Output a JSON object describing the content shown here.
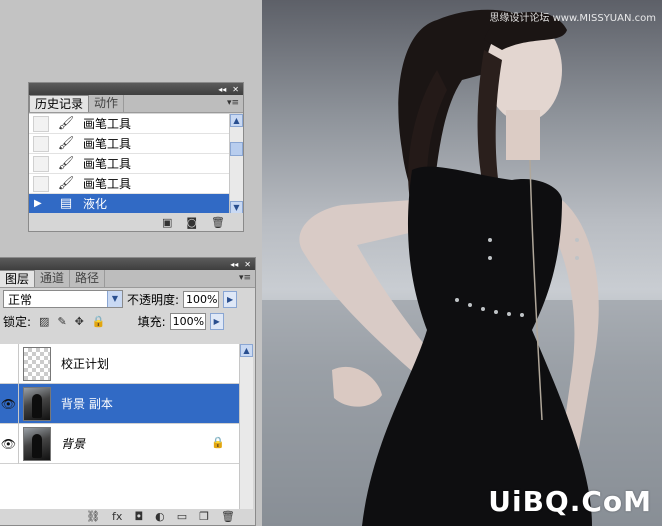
{
  "history_panel": {
    "tabs": [
      {
        "label": "历史记录",
        "active": true
      },
      {
        "label": "动作",
        "active": false
      }
    ],
    "items": [
      {
        "label": "画笔工具",
        "icon": "brush-icon",
        "selected": false
      },
      {
        "label": "画笔工具",
        "icon": "brush-icon",
        "selected": false
      },
      {
        "label": "画笔工具",
        "icon": "brush-icon",
        "selected": false
      },
      {
        "label": "画笔工具",
        "icon": "brush-icon",
        "selected": false
      },
      {
        "label": "液化",
        "icon": "liquify-icon",
        "selected": true
      }
    ]
  },
  "layers_panel": {
    "tabs": [
      {
        "label": "图层",
        "active": true
      },
      {
        "label": "通道",
        "active": false
      },
      {
        "label": "路径",
        "active": false
      }
    ],
    "blend_mode": "正常",
    "opacity_label": "不透明度:",
    "opacity_value": "100%",
    "lock_label": "锁定:",
    "fill_label": "填充:",
    "fill_value": "100%",
    "layers": [
      {
        "name": "校正计划",
        "visible": false,
        "selected": false,
        "locked": false,
        "thumbnail": "transparent"
      },
      {
        "name": "背景 副本",
        "visible": true,
        "selected": true,
        "locked": false,
        "thumbnail": "photo"
      },
      {
        "name": "背景",
        "visible": true,
        "selected": false,
        "locked": true,
        "thumbnail": "photo"
      }
    ],
    "bottom_icons": [
      "link-icon",
      "fx-icon",
      "mask-icon",
      "adjustment-icon",
      "folder-icon",
      "new-layer-icon",
      "trash-icon"
    ]
  },
  "watermarks": {
    "top": "思缘设计论坛 www.MISSYUAN.com",
    "bottom": "UiBQ.CoM"
  },
  "colors": {
    "selection": "#316ac5",
    "panel_bg": "#d6d6d6",
    "workspace": "#c3c3c3"
  }
}
